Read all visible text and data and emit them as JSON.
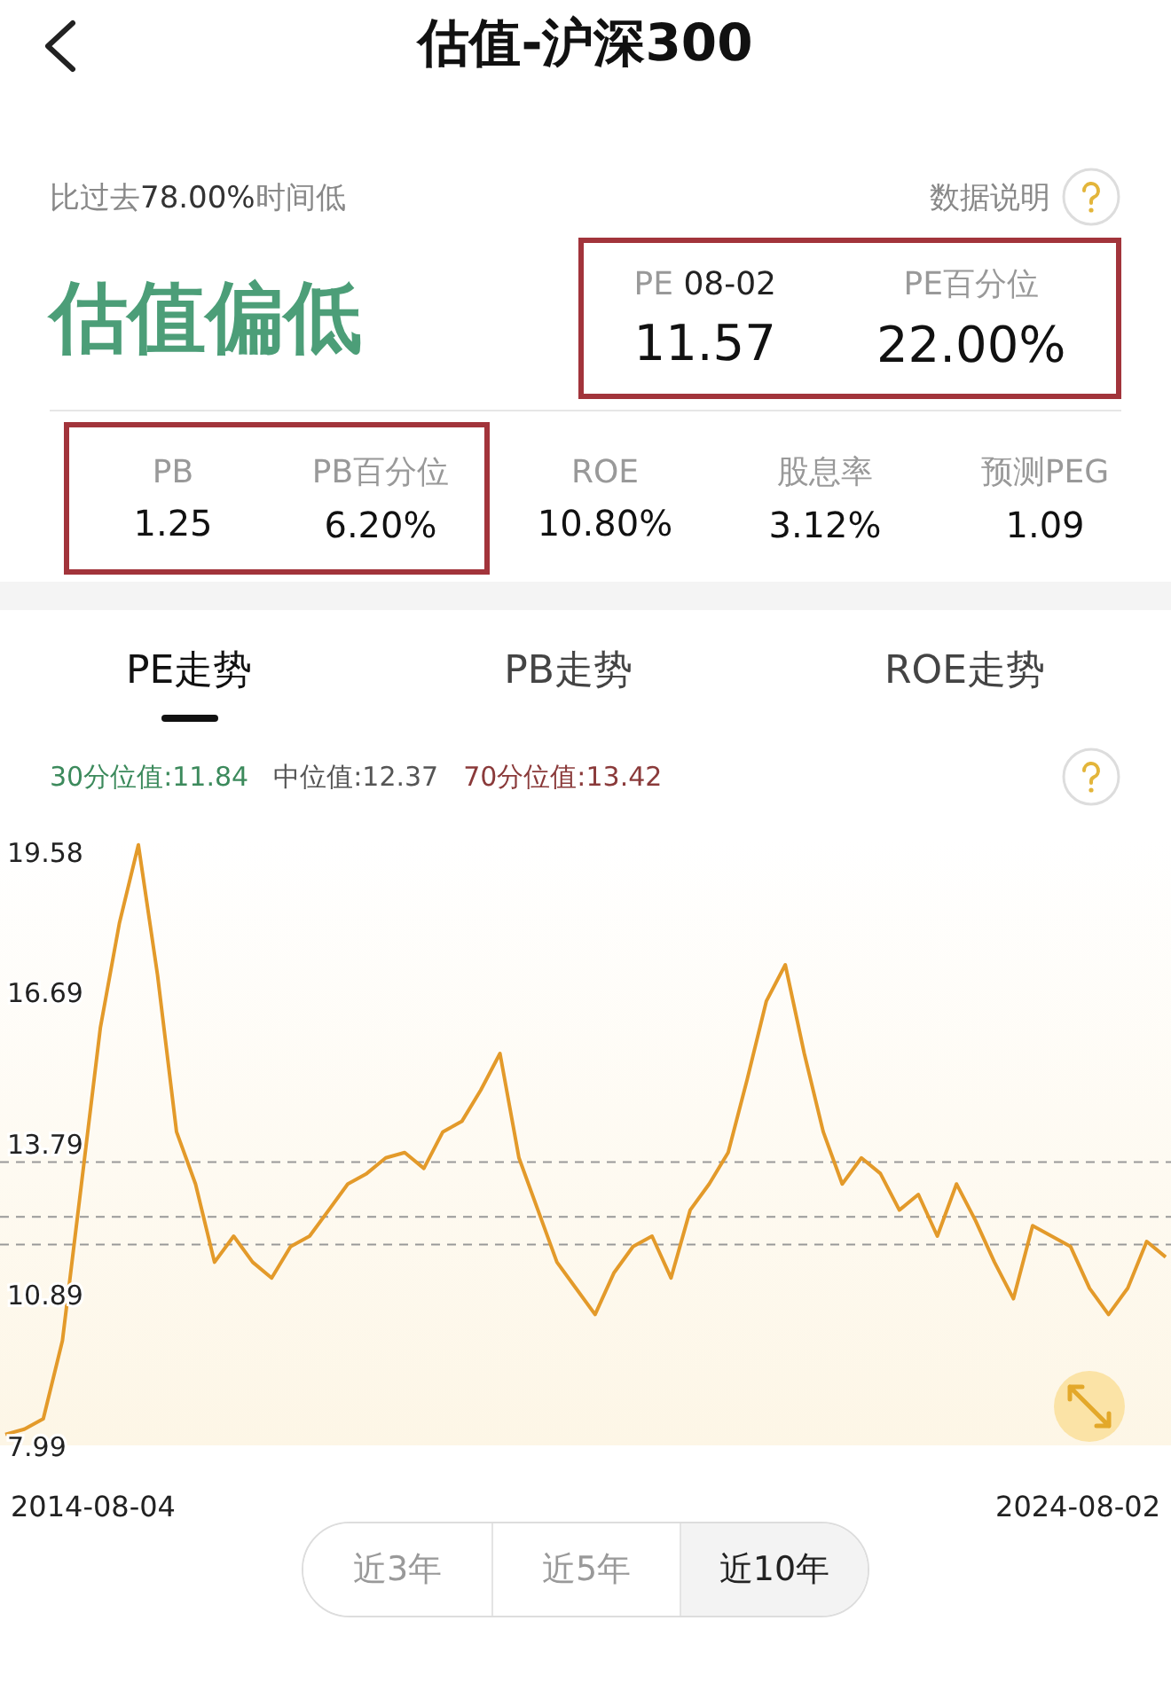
{
  "header": {
    "title": "估值-沪深300"
  },
  "summary": {
    "prefix": "比过去",
    "percent": "78.00%",
    "suffix": "时间低",
    "help_label": "数据说明",
    "verdict": "估值偏低"
  },
  "pe_box": {
    "highlighted": true,
    "label": "PE",
    "date": "08-02",
    "value": "11.57",
    "pct_label": "PE百分位",
    "pct_value": "22.00%"
  },
  "metric_groups": [
    {
      "highlighted": true,
      "items": [
        {
          "label": "PB",
          "value": "1.25"
        },
        {
          "label": "PB百分位",
          "value": "6.20%"
        }
      ]
    },
    {
      "highlighted": false,
      "items": [
        {
          "label": "ROE",
          "value": "10.80%"
        },
        {
          "label": "股息率",
          "value": "3.12%"
        },
        {
          "label": "预测PEG",
          "value": "1.09"
        }
      ]
    }
  ],
  "tabs": [
    {
      "label": "PE走势",
      "selected": true
    },
    {
      "label": "PB走势",
      "selected": false
    },
    {
      "label": "ROE走势",
      "selected": false
    }
  ],
  "legend": [
    {
      "label": "30分位值:",
      "value": "11.84",
      "color": "#3c8a5c"
    },
    {
      "label": "中位值:",
      "value": "12.37",
      "color": "#555555"
    },
    {
      "label": "70分位值:",
      "value": "13.42",
      "color": "#8a3a3a"
    }
  ],
  "chart": {
    "start_date": "2014-08-04",
    "end_date": "2024-08-02",
    "chart_data": {
      "type": "line",
      "ylim": [
        7.99,
        19.58
      ],
      "yticks": [
        7.99,
        10.89,
        13.79,
        16.69,
        19.58
      ],
      "series": [
        {
          "color": "#e39a2a",
          "values": [
            8.2,
            8.3,
            8.5,
            10,
            13,
            16,
            18,
            19.5,
            17,
            14,
            13,
            11.5,
            12,
            11.5,
            11.2,
            11.8,
            12,
            12.5,
            13,
            13.2,
            13.5,
            13.6,
            13.3,
            14,
            14.2,
            14.8,
            15.5,
            13.5,
            12.5,
            11.5,
            11,
            10.5,
            11.3,
            11.8,
            12,
            11.2,
            12.5,
            13,
            13.6,
            15,
            16.5,
            17.2,
            15.5,
            14,
            13,
            13.5,
            13.2,
            12.5,
            12.8,
            12,
            13,
            12.3,
            11.5,
            10.8,
            12.2,
            12,
            11.8,
            11,
            10.5,
            11,
            11.9,
            11.6
          ]
        }
      ]
    }
  },
  "ranges": [
    {
      "label": "近3年",
      "selected": false
    },
    {
      "label": "近5年",
      "selected": false
    },
    {
      "label": "近10年",
      "selected": true
    }
  ]
}
